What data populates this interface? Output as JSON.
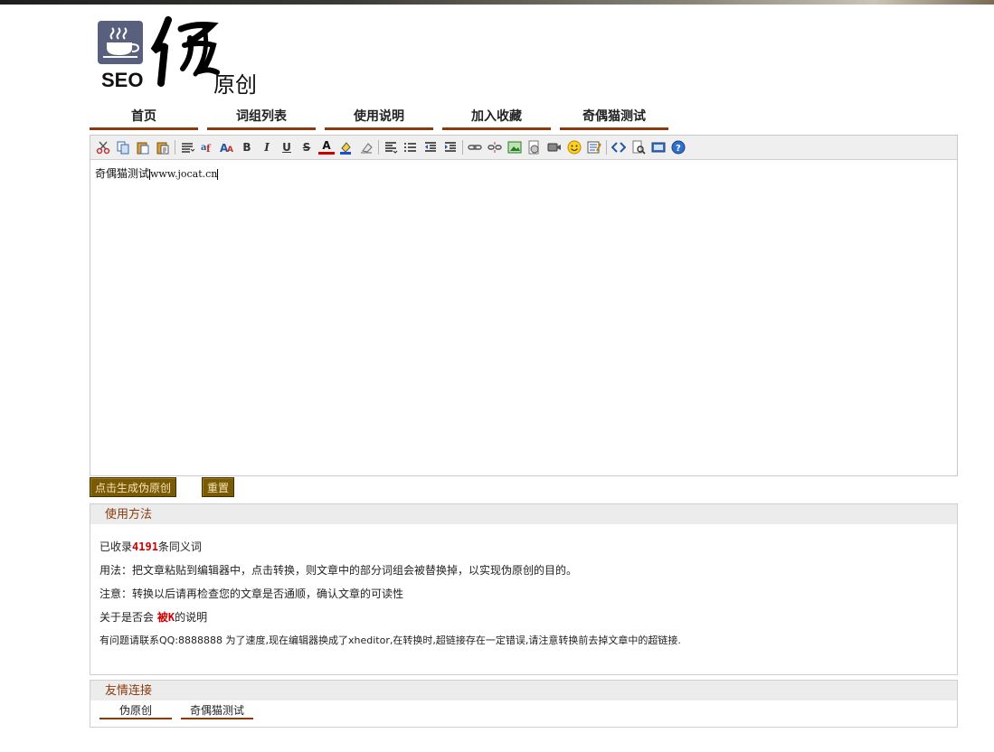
{
  "logo": {
    "brand": "SEO",
    "callig": "伪",
    "subtitle": "原创"
  },
  "nav": {
    "items": [
      {
        "label": "首页",
        "id": "home"
      },
      {
        "label": "词组列表",
        "id": "phrase-list"
      },
      {
        "label": "使用说明",
        "id": "instructions"
      },
      {
        "label": "加入收藏",
        "id": "add-favorite"
      },
      {
        "label": "奇偶猫测试",
        "id": "jocat-test"
      }
    ]
  },
  "toolbar": {
    "buttons": [
      "cut-icon",
      "copy-icon",
      "paste-icon",
      "paste-text-icon",
      "blocktag-icon",
      "font-family-icon",
      "font-size-icon",
      "bold-icon",
      "italic-icon",
      "underline-icon",
      "strikethrough-icon",
      "font-color-icon",
      "background-color-icon",
      "remove-format-icon",
      "align-icon",
      "list-icon",
      "outdent-icon",
      "indent-icon",
      "link-icon",
      "unlink-icon",
      "image-icon",
      "flash-icon",
      "media-icon",
      "emoticon-icon",
      "table-icon",
      "source-icon",
      "preview-icon",
      "fullscreen-icon",
      "about-icon"
    ],
    "bold": "B",
    "italic": "I",
    "underline": "U",
    "strike": "S",
    "fontcolor": "A"
  },
  "editor": {
    "text_prefix": "奇偶猫测试",
    "text_url": "www.jocat.cn"
  },
  "buttons": {
    "generate": "点击生成伪原创",
    "reset": "重置"
  },
  "usage": {
    "title": "使用方法",
    "count_prefix": "已收录",
    "count": "4191",
    "count_suffix": "条同义词",
    "line_usage": "用法：把文章粘贴到编辑器中，点击转换，则文章中的部分词组会被替换掉，以实现伪原创的目的。",
    "line_note": "注意：转换以后请再检查您的文章是否通顺，确认文章的可读性",
    "k_prefix": "关于是否会",
    "k_word": "被K",
    "k_suffix": "的说明",
    "line_qq": "有问题请联系QQ:8888888 为了速度,现在编辑器换成了xheditor,在转换时,超链接存在一定错误,请注意转换前去掉文章中的超链接."
  },
  "friends": {
    "title": "友情连接",
    "links": [
      "伪原创",
      "奇偶猫测试"
    ]
  },
  "colors": {
    "accent": "#8b3a0c",
    "button_bg": "#7a5a04",
    "highlight": "#d00000"
  }
}
